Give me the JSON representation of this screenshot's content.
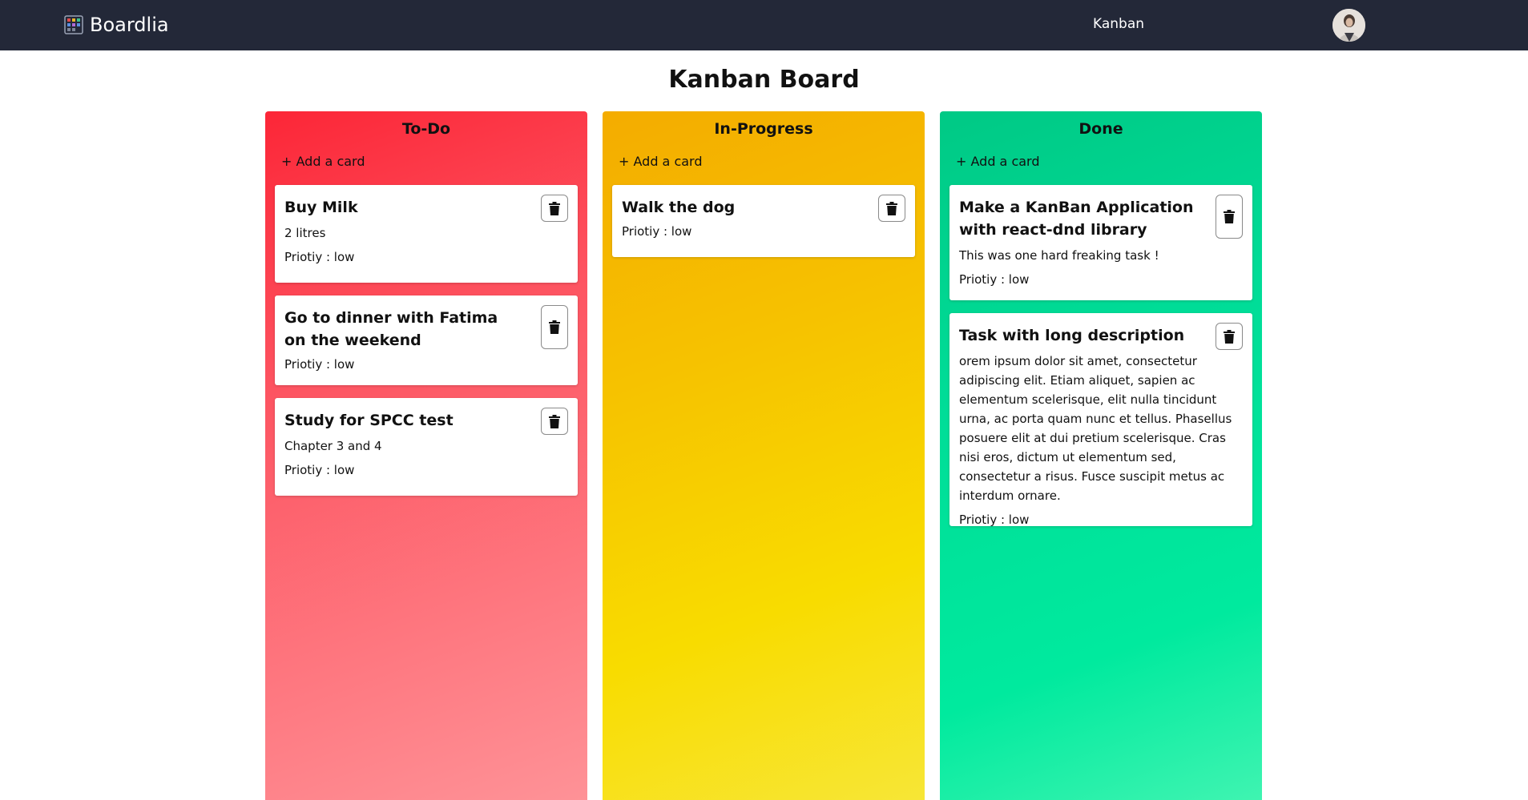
{
  "app": {
    "brand": "Boardlia",
    "nav_link": "Kanban",
    "page_title": "Kanban Board"
  },
  "icons": {
    "brand": "kanban-grid-icon",
    "delete": "trash-icon",
    "avatar": "user-avatar"
  },
  "colors": {
    "navbar": "#232838",
    "todo": "#fc2637",
    "in_progress": "#f4ac00",
    "done": "#00c985"
  },
  "columns": [
    {
      "title": "To-Do",
      "add_label": "+ Add a card",
      "cards": [
        {
          "title": "Buy Milk",
          "description": "2 litres",
          "priority": "Priotiy : low"
        },
        {
          "title": "Go to dinner with Fatima on the weekend",
          "description": "",
          "priority": "Priotiy : low"
        },
        {
          "title": "Study for SPCC test",
          "description": "Chapter 3 and 4",
          "priority": "Priotiy : low"
        }
      ]
    },
    {
      "title": "In-Progress",
      "add_label": "+ Add a card",
      "cards": [
        {
          "title": "Walk the dog",
          "description": "",
          "priority": "Priotiy : low"
        }
      ]
    },
    {
      "title": "Done",
      "add_label": "+ Add a card",
      "cards": [
        {
          "title": "Make a KanBan Application with react-dnd library",
          "description": "This was one hard freaking task !",
          "priority": "Priotiy : low"
        },
        {
          "title": "Task with long description",
          "description": "orem ipsum dolor sit amet, consectetur adipiscing elit. Etiam aliquet, sapien ac elementum scelerisque, elit nulla tincidunt urna, ac porta quam nunc et tellus. Phasellus posuere elit at dui pretium scelerisque. Cras nisi eros, dictum ut elementum sed, consectetur a risus. Fusce suscipit metus ac interdum ornare.",
          "priority": "Priotiy : low"
        }
      ]
    }
  ]
}
